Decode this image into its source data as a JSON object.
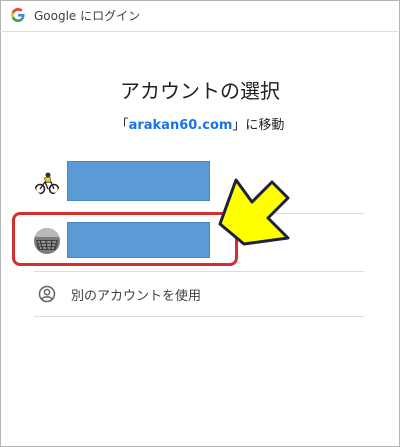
{
  "topbar": {
    "logo_icon": "google-g-icon",
    "title": "Google にログイン"
  },
  "heading": "アカウントの選択",
  "subheading": {
    "prefix": "「",
    "domain": "arakan60.com",
    "suffix": "」に移動"
  },
  "accounts": [
    {
      "avatar_icon": "cyclist-avatar-icon",
      "redacted": true
    },
    {
      "avatar_icon": "photo-avatar-icon",
      "redacted": true,
      "highlighted": true
    }
  ],
  "use_other": {
    "icon": "person-circle-icon",
    "label": "別のアカウントを使用"
  },
  "colors": {
    "accent": "#1a73e8",
    "redaction": "#5b9bd5",
    "highlight": "#d32f2f",
    "arrow_fill": "#ffff00"
  }
}
